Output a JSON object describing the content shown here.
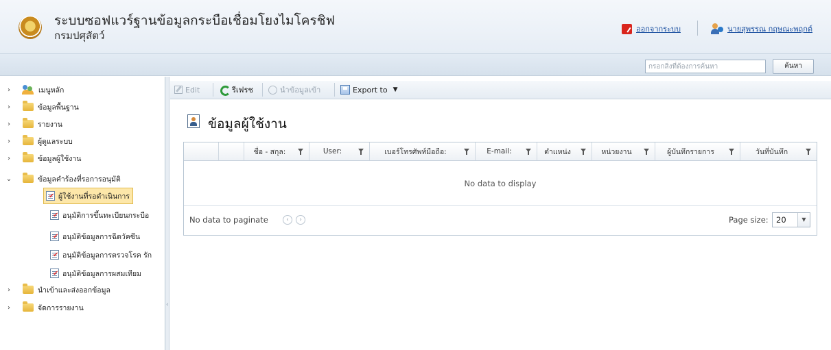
{
  "header": {
    "title": "ระบบซอฟแวร์ฐานข้อมูลกระบือเชื่อมโยงไมโครชิฟ",
    "subtitle": "กรมปศุสัตว์",
    "logout_label": "ออกจากระบบ",
    "user_name": "นายสุพรรณ กฤษณะพฤกต์"
  },
  "search": {
    "placeholder": "กรอกสิ่งที่ต้องการค้นหา",
    "button_label": "ค้นหา"
  },
  "sidebar": {
    "items": [
      {
        "label": "เมนูหลัก",
        "icon": "people-icon",
        "chevron": "›"
      },
      {
        "label": "ข้อมูลพื้นฐาน",
        "icon": "folder-icon",
        "chevron": "›"
      },
      {
        "label": "รายงาน",
        "icon": "folder-icon",
        "chevron": "›"
      },
      {
        "label": "ผู้ดูแลระบบ",
        "icon": "folder-icon",
        "chevron": "›"
      },
      {
        "label": "ข้อมูลผู้ใช้งาน",
        "icon": "folder-icon",
        "chevron": "›"
      },
      {
        "label": "ข้อมูลคำร้องที่รอการอนุมัติ",
        "icon": "folder-icon",
        "chevron": "⌄"
      },
      {
        "label": "ผู้ใช้งานที่รอดำเนินการ",
        "icon": "doc-check-icon",
        "selected": true
      },
      {
        "label": "อนุมัติการขึ้นทะเบียนกระบือ",
        "icon": "doc-check-icon"
      },
      {
        "label": "อนุมัติข้อมูลการฉีดวัคซีน",
        "icon": "doc-check-icon"
      },
      {
        "label": "อนุมัติข้อมูลการตรวจโรค รัก",
        "icon": "doc-check-icon"
      },
      {
        "label": "อนุมัติข้อมูลการผสมเทียม",
        "icon": "doc-check-icon"
      },
      {
        "label": "นำเข้าและส่งออกข้อมูล",
        "icon": "folder-icon",
        "chevron": "›"
      },
      {
        "label": "จัดการรายงาน",
        "icon": "folder-icon",
        "chevron": "›"
      }
    ]
  },
  "toolbar": {
    "edit_label": "Edit",
    "refresh_label": "รีเฟรช",
    "import_label": "นำข้อมูลเข้า",
    "export_label": "Export to"
  },
  "page": {
    "title": "ข้อมูลผู้ใช้งาน"
  },
  "grid": {
    "columns": [
      {
        "label": ""
      },
      {
        "label": ""
      },
      {
        "label": "ชื่อ - สกุล:"
      },
      {
        "label": "User:"
      },
      {
        "label": "เบอร์โทรศัพท์มือถือ:"
      },
      {
        "label": "E-mail:"
      },
      {
        "label": "ตำแหน่ง"
      },
      {
        "label": "หน่วยงาน"
      },
      {
        "label": "ผู้บันทึกรายการ"
      },
      {
        "label": "วันที่บันทึก"
      }
    ],
    "empty_text": "No data to display",
    "pager_text": "No data to paginate",
    "page_size_label": "Page size:",
    "page_size_value": "20"
  },
  "colors": {
    "accent": "#1a4fa0",
    "selected_bg": "#fde7a9",
    "header_bg": "#e6edf5",
    "refresh_green": "#2e9a3a"
  }
}
